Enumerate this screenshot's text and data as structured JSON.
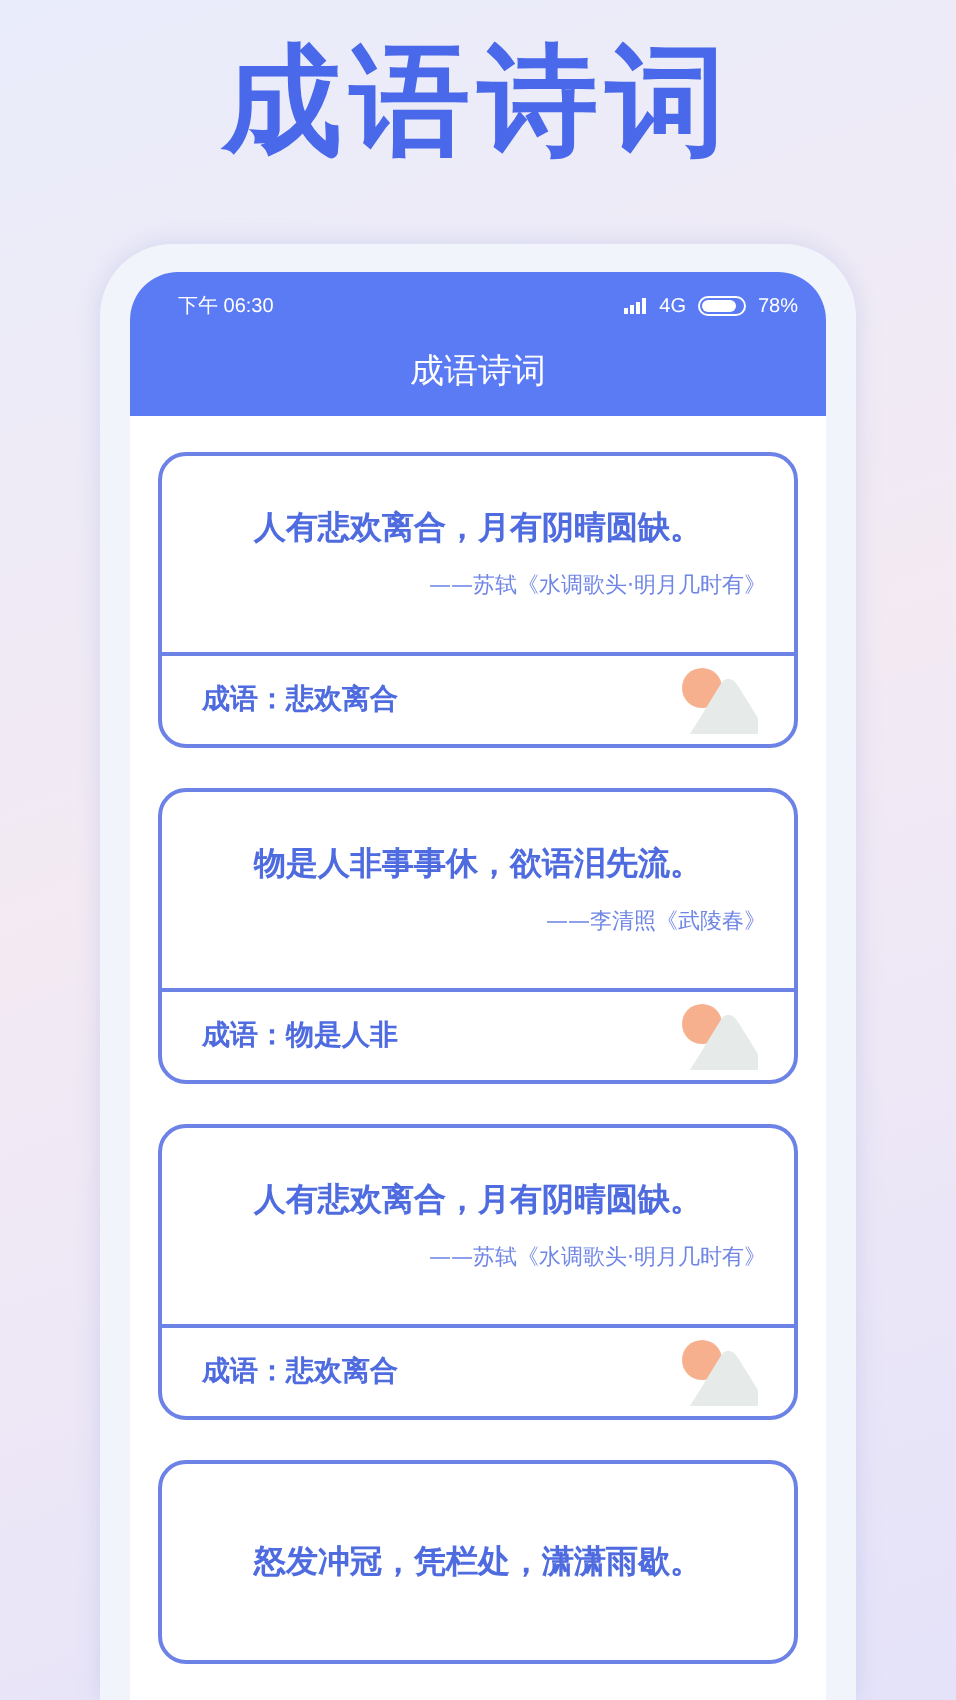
{
  "headline": "成语诗词",
  "status_bar": {
    "time": "下午 06:30",
    "network": "4G",
    "battery": "78%"
  },
  "app_title": "成语诗词",
  "cards": [
    {
      "quote": "人有悲欢离合，月有阴晴圆缺。",
      "source": "——苏轼《水调歌头·明月几时有》",
      "idiom": "成语：悲欢离合"
    },
    {
      "quote": "物是人非事事休，欲语泪先流。",
      "source": "——李清照《武陵春》",
      "idiom": "成语：物是人非"
    },
    {
      "quote": "人有悲欢离合，月有阴晴圆缺。",
      "source": "——苏轼《水调歌头·明月几时有》",
      "idiom": "成语：悲欢离合"
    },
    {
      "quote": "怒发冲冠，凭栏处，潇潇雨歇。"
    }
  ]
}
